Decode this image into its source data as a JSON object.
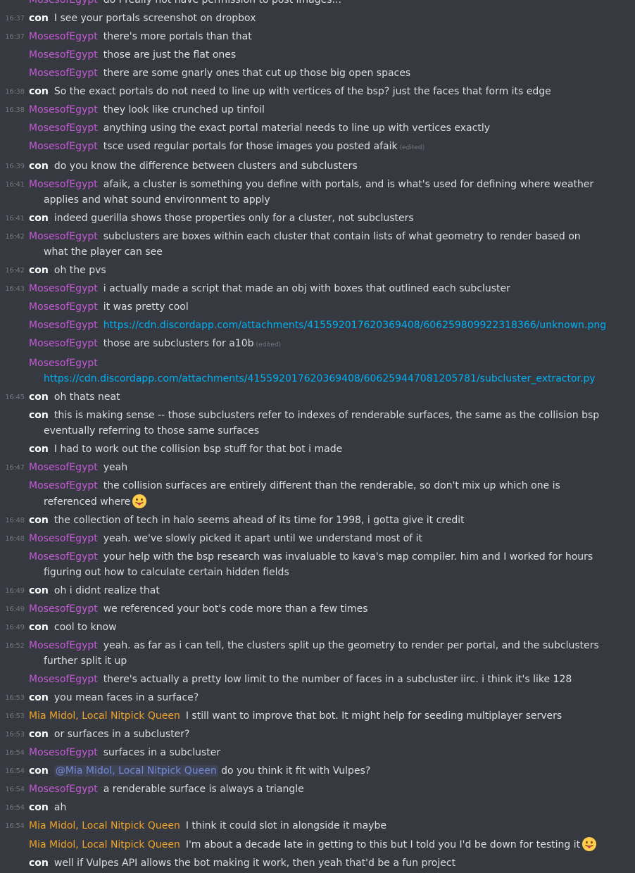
{
  "authors": {
    "con": "con",
    "moses": "MosesofEgypt",
    "mia": "Mia Midol, Local Nitpick Queen"
  },
  "edited_label": "(edited)",
  "messages": [
    {
      "ts": "",
      "author": "moses",
      "text": "do I really not have permission to post images..."
    },
    {
      "ts": "16:37",
      "author": "con",
      "text": "I see your portals screenshot on dropbox"
    },
    {
      "ts": "16:37",
      "author": "moses",
      "text": "there's more portals than that"
    },
    {
      "ts": "",
      "author": "moses",
      "text": "those are just the flat ones"
    },
    {
      "ts": "",
      "author": "moses",
      "text": "there are some gnarly ones that cut up those big open spaces"
    },
    {
      "ts": "16:38",
      "author": "con",
      "text": "So the exact portals do not need to line up with vertices of the bsp? just the faces that form its edge"
    },
    {
      "ts": "16:38",
      "author": "moses",
      "text": "they look like crunched up tinfoil"
    },
    {
      "ts": "",
      "author": "moses",
      "text": "anything using the exact portal material needs to line up with vertices exactly"
    },
    {
      "ts": "",
      "author": "moses",
      "text": "tsce used regular portals for those images you posted afaik",
      "edited": true
    },
    {
      "ts": "16:39",
      "author": "con",
      "text": "do you know the difference between clusters and subclusters"
    },
    {
      "ts": "16:41",
      "author": "moses",
      "text": "afaik, a cluster is something you define with portals, and is what's used for defining where weather applies and what sound environment to apply"
    },
    {
      "ts": "16:41",
      "author": "con",
      "text": "indeed guerilla shows those properties only for a cluster, not subclusters"
    },
    {
      "ts": "16:42",
      "author": "moses",
      "text": "subclusters are boxes within each cluster that contain lists of what geometry to render based on what the player can see"
    },
    {
      "ts": "16:42",
      "author": "con",
      "text": "oh the pvs"
    },
    {
      "ts": "16:43",
      "author": "moses",
      "text": "i actually made a script that made an obj with boxes that outlined each subcluster"
    },
    {
      "ts": "",
      "author": "moses",
      "text": "it was pretty cool"
    },
    {
      "ts": "",
      "author": "moses",
      "link": "https://cdn.discordapp.com/attachments/415592017620369408/606259809922318366/unknown.png"
    },
    {
      "ts": "",
      "author": "moses",
      "text": "those are subclusters for a10b",
      "edited": true
    },
    {
      "ts": "",
      "author": "moses",
      "link_block": "https://cdn.discordapp.com/attachments/415592017620369408/606259447081205781/subcluster_extractor.py"
    },
    {
      "ts": "16:45",
      "author": "con",
      "text": "oh thats neat"
    },
    {
      "ts": "",
      "author": "con",
      "text": "this is making sense -- those subclusters refer to indexes of renderable surfaces, the same as the collision bsp eventually referring to those same surfaces"
    },
    {
      "ts": "",
      "author": "con",
      "text": "I had to work out the collision bsp stuff for that bot i made"
    },
    {
      "ts": "16:47",
      "author": "moses",
      "text": "yeah"
    },
    {
      "ts": "",
      "author": "moses",
      "text": "the collision surfaces are entirely different than the renderable, so don't mix up which one is referenced where",
      "emoji": "tongue-emoji"
    },
    {
      "ts": "16:48",
      "author": "con",
      "text": "the collection of tech in halo seems ahead of its time for 1998, i gotta give it credit"
    },
    {
      "ts": "16:48",
      "author": "moses",
      "text": "yeah. we've slowly picked it apart until we understand most of it"
    },
    {
      "ts": "",
      "author": "moses",
      "text": "your help with the bsp research was invaluable to kava's map compiler. him and I worked for hours figuring out how to calculate certain hidden fields"
    },
    {
      "ts": "16:49",
      "author": "con",
      "text": "oh i didnt realize that"
    },
    {
      "ts": "16:49",
      "author": "moses",
      "text": "we referenced your bot's code more than a few times"
    },
    {
      "ts": "16:49",
      "author": "con",
      "text": "cool to know"
    },
    {
      "ts": "16:52",
      "author": "moses",
      "text": "yeah. as far as i can tell, the clusters split up the geometry to render per portal, and the subclusters further split it up"
    },
    {
      "ts": "",
      "author": "moses",
      "text": "there's actually a pretty low limit to the number of faces in a subcluster iirc. i think it's like 128"
    },
    {
      "ts": "16:53",
      "author": "con",
      "text": "you mean faces in a surface?"
    },
    {
      "ts": "16:53",
      "author": "mia",
      "text": "I still want to improve that bot. It might help for seeding multiplayer servers"
    },
    {
      "ts": "16:53",
      "author": "con",
      "text": "or surfaces in a subcluster?"
    },
    {
      "ts": "16:54",
      "author": "moses",
      "text": "surfaces in a subcluster"
    },
    {
      "ts": "16:54",
      "author": "con",
      "mention": "@Mia Midol, Local Nitpick Queen",
      "text": "do you think it fit with Vulpes?"
    },
    {
      "ts": "16:54",
      "author": "moses",
      "text": "a renderable surface is always a triangle"
    },
    {
      "ts": "16:54",
      "author": "con",
      "text": "ah"
    },
    {
      "ts": "16:54",
      "author": "mia",
      "text": "I think it could slot in alongside it maybe"
    },
    {
      "ts": "",
      "author": "mia",
      "text": "I'm about a decade late in getting to this but I told you I'd be down for testing it",
      "emoji": "tongue-emoji"
    },
    {
      "ts": "",
      "author": "con",
      "text": "well if Vulpes API allows the bot  making it work, then yeah that'd be a fun project"
    }
  ]
}
